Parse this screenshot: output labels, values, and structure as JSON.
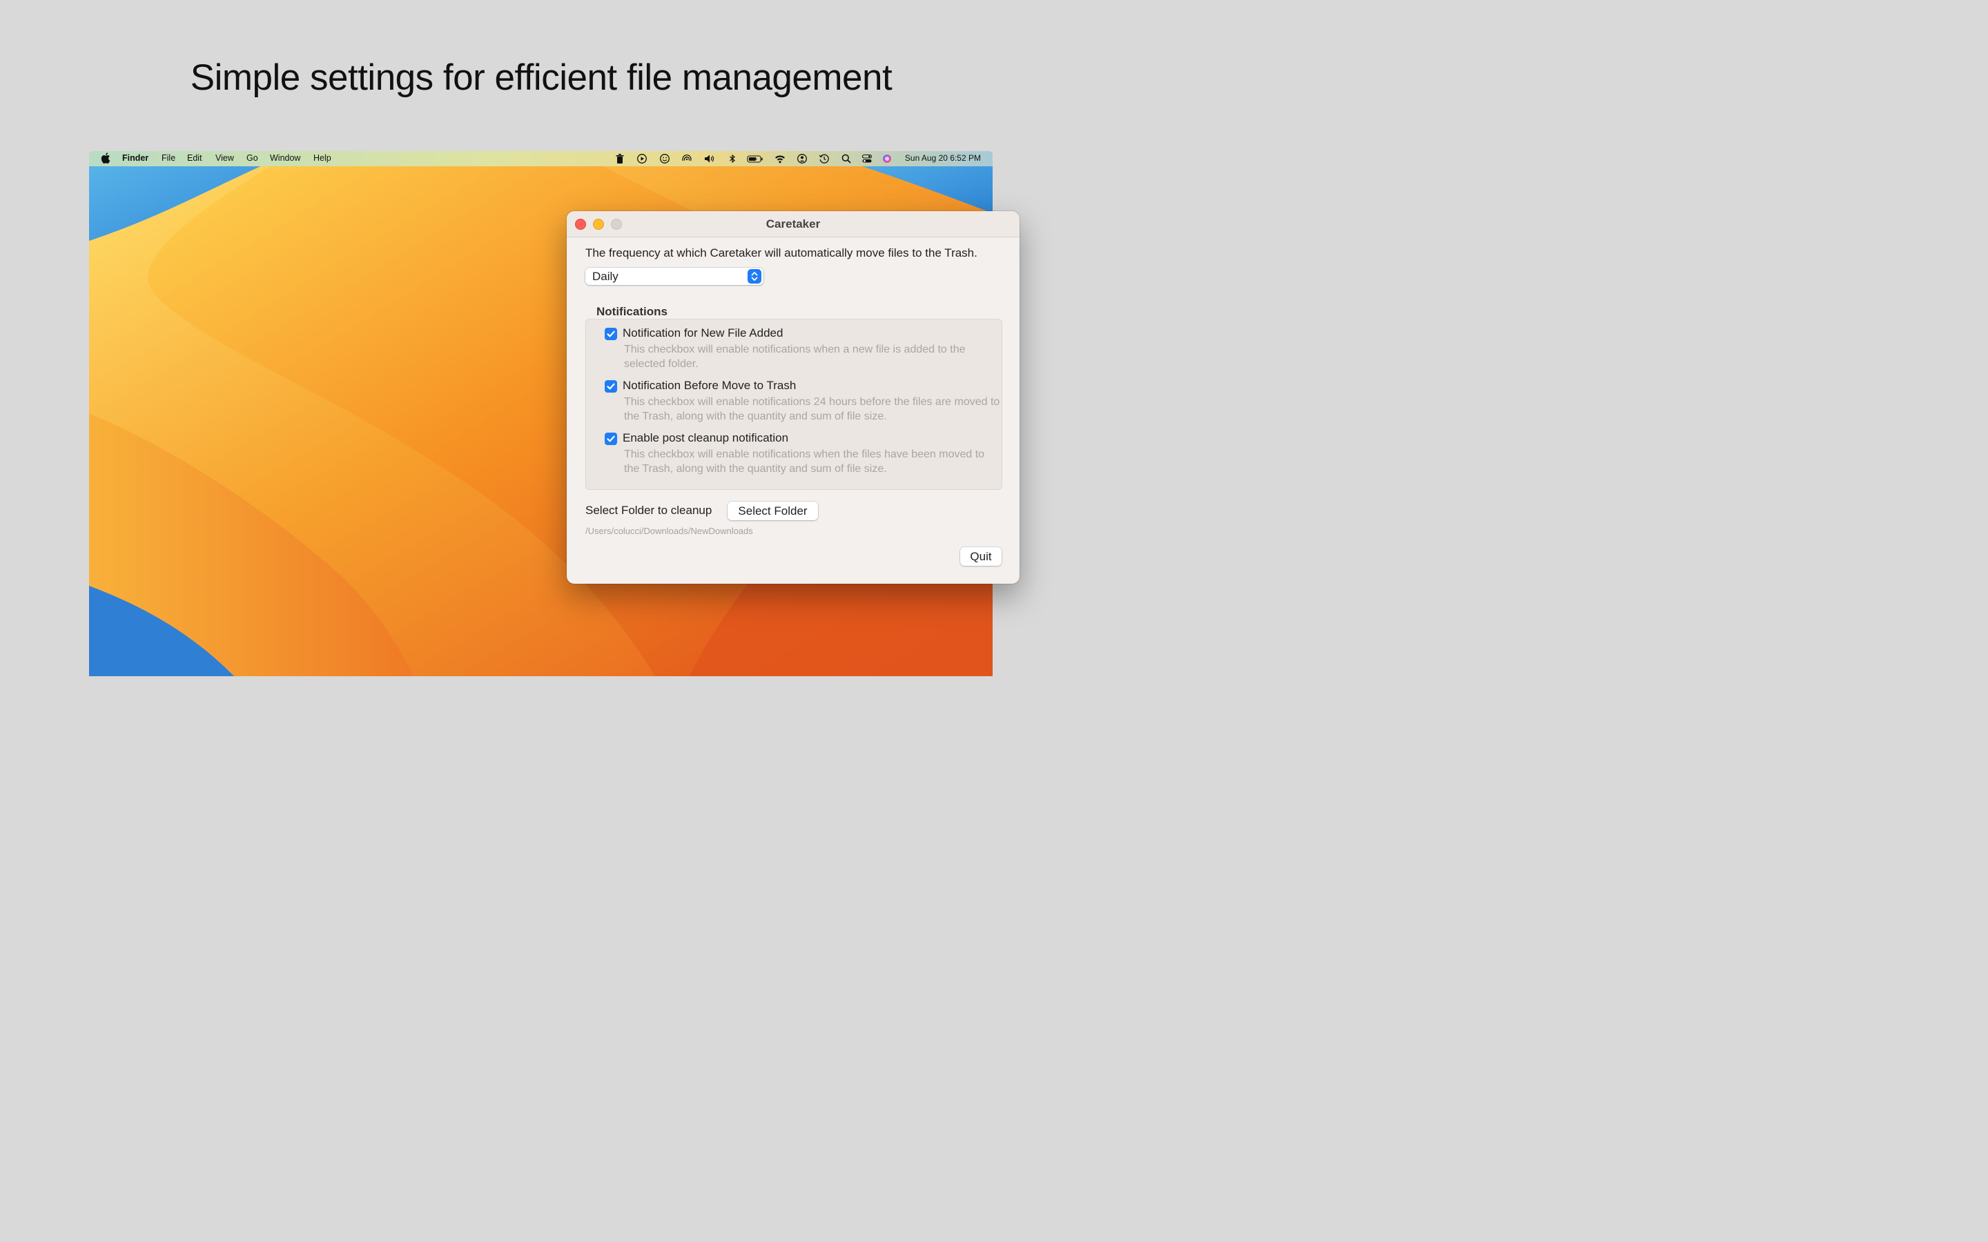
{
  "headline": "Simple settings for efficient file management",
  "menubar": {
    "apple_icon": "apple-logo-icon",
    "app_name": "Finder",
    "menus": [
      "File",
      "Edit",
      "View",
      "Go",
      "Window",
      "Help"
    ],
    "status_icons": [
      "trash-icon",
      "play-circle-icon",
      "smiley-icon",
      "airdrop-icon",
      "volume-icon",
      "bluetooth-icon",
      "battery-icon",
      "wifi-icon",
      "user-account-icon",
      "time-machine-icon",
      "spotlight-search-icon",
      "control-center-icon",
      "siri-icon"
    ],
    "clock": "Sun Aug 20  6:52 PM"
  },
  "window": {
    "title": "Caretaker",
    "frequency_text": "The frequency at which Caretaker will automatically move files to the Trash.",
    "frequency_value": "Daily",
    "notifications": {
      "title": "Notifications",
      "options": [
        {
          "label": "Notification for New File Added",
          "description": "This checkbox will enable notifications when a new file is added to the selected folder.",
          "checked": true
        },
        {
          "label": "Notification Before Move to Trash",
          "description": "This checkbox will enable notifications 24 hours before the files are moved to the Trash, along with the quantity and sum of file size.",
          "checked": true
        },
        {
          "label": "Enable post cleanup notification",
          "description": "This checkbox will enable notifications when the files have been moved to the Trash, along with the quantity and sum of file size.",
          "checked": true
        }
      ]
    },
    "folder_label": "Select Folder to cleanup",
    "select_folder_button": "Select Folder",
    "folder_path": "/Users/colucci/Downloads/NewDownloads",
    "quit_button": "Quit"
  },
  "colors": {
    "accent": "#1f7cf4",
    "close": "#fe5f57",
    "minimize": "#febc2e",
    "background": "#d9d9d9"
  }
}
